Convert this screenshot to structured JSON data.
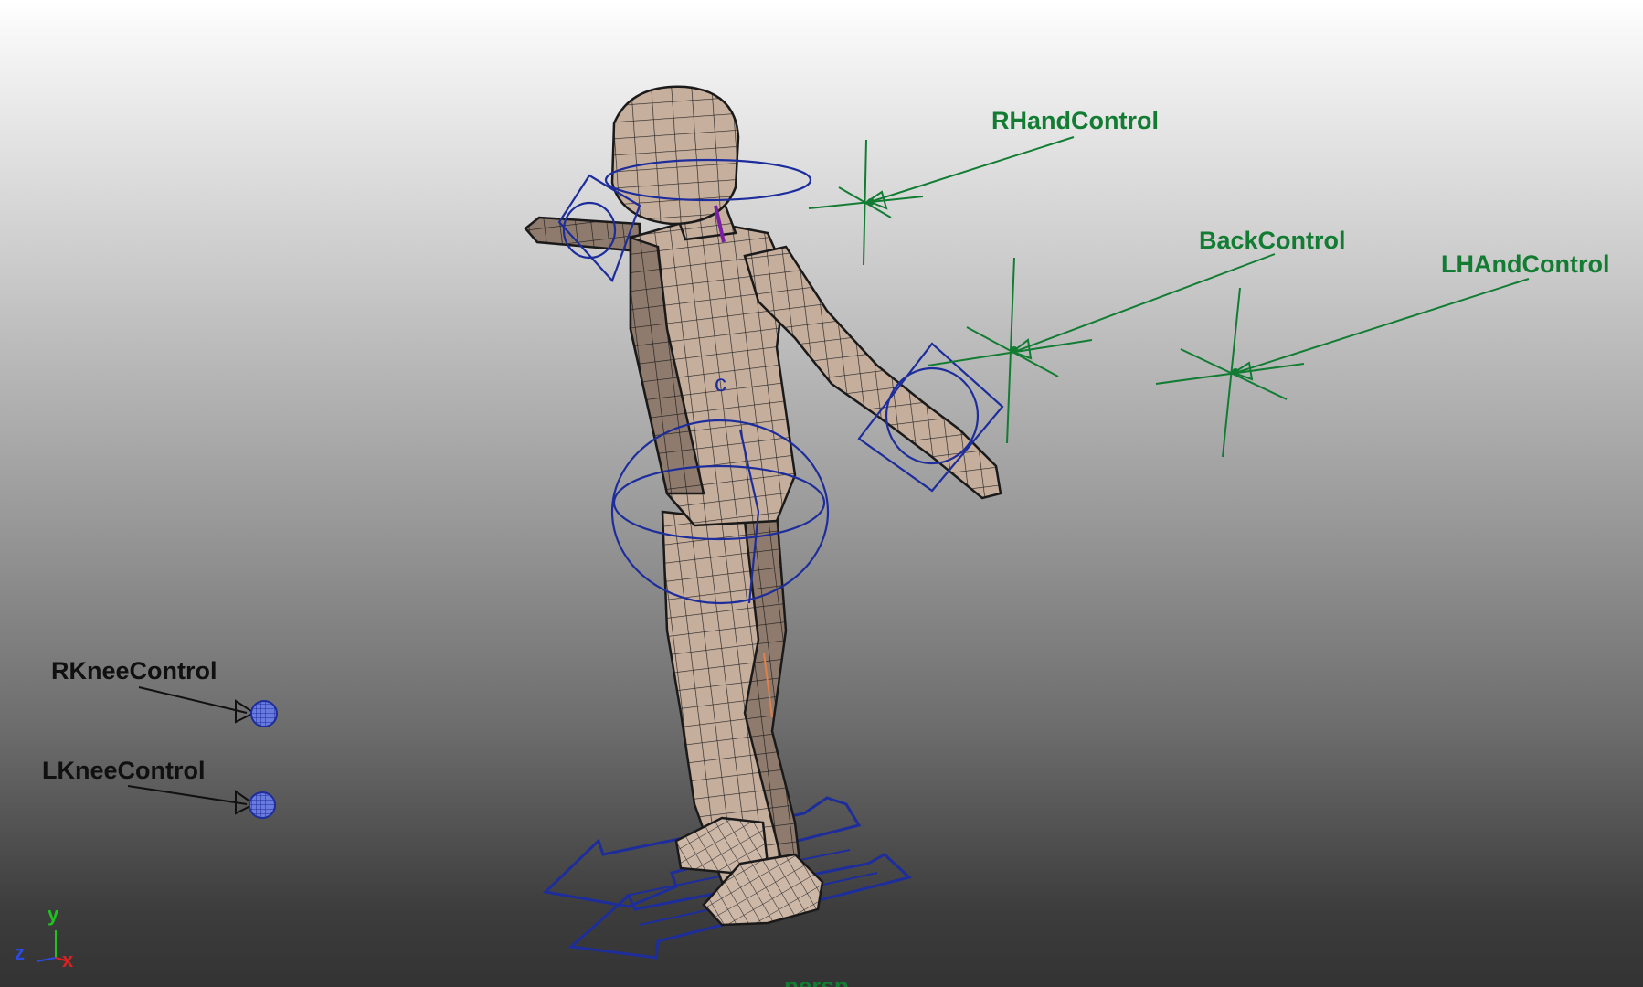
{
  "viewport": {
    "camera_label": "persp",
    "controls": {
      "rhand": "RHandControl",
      "back": "BackControl",
      "lhand": "LHAndControl",
      "rknee": "RKneeControl",
      "lknee": "LKneeControl"
    },
    "axis": {
      "y": "y",
      "z": "z",
      "x": "x"
    },
    "colors": {
      "control_green": "#127c33",
      "control_blue": "#1d2d9c",
      "skin": "#c9b2a2",
      "wire": "#1a1a1a"
    }
  }
}
